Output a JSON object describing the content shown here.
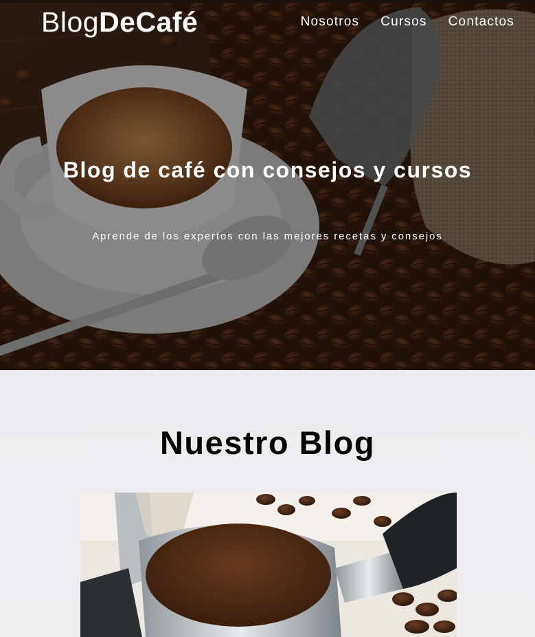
{
  "header": {
    "logo_light": "Blog",
    "logo_bold": "DeCafé"
  },
  "nav": {
    "items": [
      {
        "label": "Nosotros"
      },
      {
        "label": "Cursos"
      },
      {
        "label": "Contactos"
      }
    ]
  },
  "hero": {
    "title": "Blog de café con consejos y cursos",
    "subtitle": "Aprende de los expertos con las mejores recetas y consejos"
  },
  "blog": {
    "title": "Nuestro Blog"
  },
  "colors": {
    "text_light": "#ffffff",
    "text_dark": "#050505",
    "section_bg": "#efedf0"
  }
}
